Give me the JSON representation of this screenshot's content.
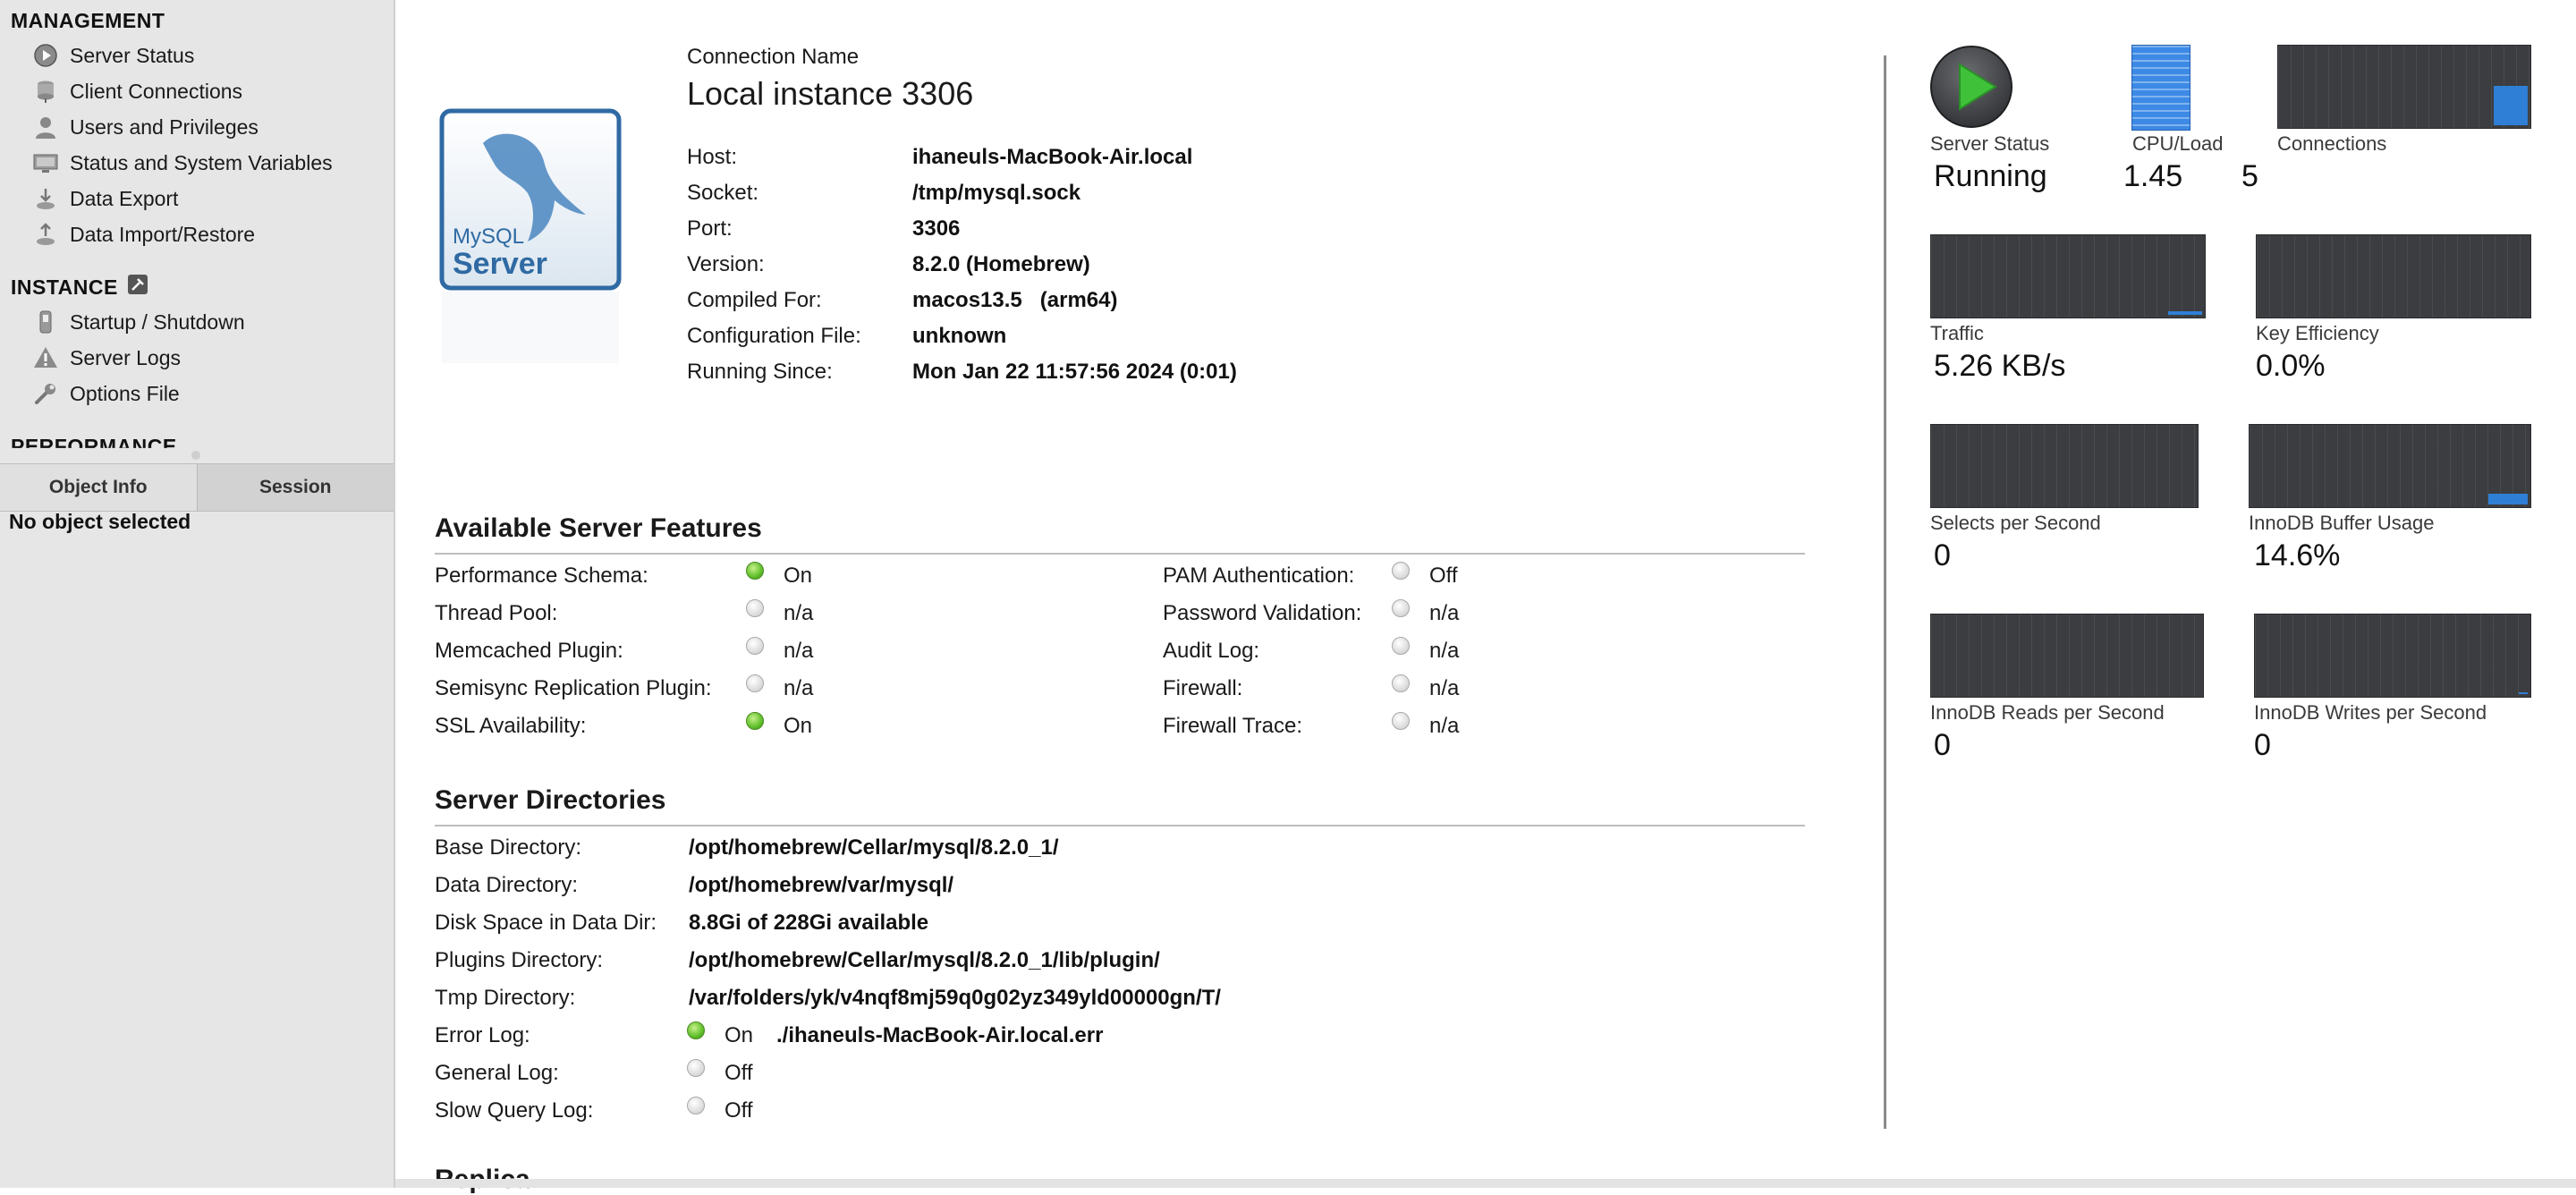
{
  "sidebar": {
    "management_title": "MANAGEMENT",
    "management_items": [
      {
        "label": "Server Status",
        "icon": "play-circle-icon"
      },
      {
        "label": "Client Connections",
        "icon": "connections-icon"
      },
      {
        "label": "Users and Privileges",
        "icon": "user-icon"
      },
      {
        "label": "Status and System Variables",
        "icon": "monitor-icon"
      },
      {
        "label": "Data Export",
        "icon": "export-icon"
      },
      {
        "label": "Data Import/Restore",
        "icon": "import-icon"
      }
    ],
    "instance_title": "INSTANCE",
    "instance_items": [
      {
        "label": "Startup / Shutdown",
        "icon": "power-switch-icon"
      },
      {
        "label": "Server Logs",
        "icon": "warning-icon"
      },
      {
        "label": "Options File",
        "icon": "wrench-icon"
      }
    ],
    "performance_title": "PERFORMANCE",
    "tabs": [
      "Object Info",
      "Session"
    ],
    "no_object": "No object selected"
  },
  "connection": {
    "name_label": "Connection Name",
    "name": "Local instance 3306",
    "logo_text_1": "MySQL",
    "logo_text_2": "Server",
    "fields": [
      {
        "label": "Host:",
        "value": "ihaneuls-MacBook-Air.local"
      },
      {
        "label": "Socket:",
        "value": "/tmp/mysql.sock"
      },
      {
        "label": "Port:",
        "value": "3306"
      },
      {
        "label": "Version:",
        "value": "8.2.0 (Homebrew)"
      },
      {
        "label": "Compiled For:",
        "value": "macos13.5   (arm64)"
      },
      {
        "label": "Configuration File:",
        "value": "unknown"
      },
      {
        "label": "Running Since:",
        "value": "Mon Jan 22 11:57:56 2024 (0:01)"
      }
    ]
  },
  "features": {
    "title": "Available Server Features",
    "left": [
      {
        "label": "Performance Schema:",
        "status": "On",
        "state": "on"
      },
      {
        "label": "Thread Pool:",
        "status": "n/a",
        "state": "off"
      },
      {
        "label": "Memcached Plugin:",
        "status": "n/a",
        "state": "off"
      },
      {
        "label": "Semisync Replication Plugin:",
        "status": "n/a",
        "state": "off"
      },
      {
        "label": "SSL Availability:",
        "status": "On",
        "state": "on"
      }
    ],
    "right": [
      {
        "label": "PAM Authentication:",
        "status": "Off",
        "state": "off"
      },
      {
        "label": "Password Validation:",
        "status": "n/a",
        "state": "off"
      },
      {
        "label": "Audit Log:",
        "status": "n/a",
        "state": "off"
      },
      {
        "label": "Firewall:",
        "status": "n/a",
        "state": "off"
      },
      {
        "label": "Firewall Trace:",
        "status": "n/a",
        "state": "off"
      }
    ]
  },
  "directories": {
    "title": "Server Directories",
    "items": [
      {
        "label": "Base Directory:",
        "value": "/opt/homebrew/Cellar/mysql/8.2.0_1/"
      },
      {
        "label": "Data Directory:",
        "value": "/opt/homebrew/var/mysql/"
      },
      {
        "label": "Disk Space in Data Dir:",
        "value": "8.8Gi of 228Gi available"
      },
      {
        "label": "Plugins Directory:",
        "value": "/opt/homebrew/Cellar/mysql/8.2.0_1/lib/plugin/"
      },
      {
        "label": "Tmp Directory:",
        "value": "/var/folders/yk/v4nqf8mj59q0g02yz349yld00000gn/T/"
      }
    ],
    "logs": [
      {
        "label": "Error Log:",
        "status": "On",
        "state": "on",
        "value": "./ihaneuls-MacBook-Air.local.err"
      },
      {
        "label": "General Log:",
        "status": "Off",
        "state": "off",
        "value": ""
      },
      {
        "label": "Slow Query Log:",
        "status": "Off",
        "state": "off",
        "value": ""
      }
    ],
    "next_section": "Replica"
  },
  "dashboard": {
    "server_status_label": "Server Status",
    "server_status_value": "Running",
    "cpu_label": "CPU/Load",
    "cpu_value": "1.45",
    "connections_label": "Connections",
    "connections_value": "5",
    "metrics": [
      {
        "label": "Traffic",
        "value": "5.26 KB/s"
      },
      {
        "label": "Key Efficiency",
        "value": "0.0%"
      },
      {
        "label": "Selects per Second",
        "value": "0"
      },
      {
        "label": "InnoDB Buffer Usage",
        "value": "14.6%"
      },
      {
        "label": "InnoDB Reads per Second",
        "value": "0"
      },
      {
        "label": "InnoDB Writes per Second",
        "value": "0"
      }
    ],
    "colors": {
      "accent": "#2f7fd6",
      "graph_bg": "#3b3d40",
      "status_on": "#5fbf2a"
    }
  }
}
